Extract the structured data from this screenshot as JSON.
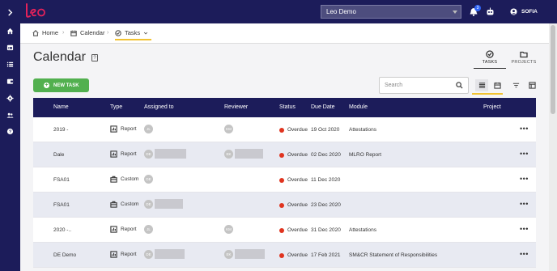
{
  "topbar": {
    "logo_text": "leo",
    "organization": "Leo Demo",
    "notification_count": "3",
    "user_name": "SOFIA"
  },
  "breadcrumb": {
    "home": "Home",
    "calendar": "Calendar",
    "tasks": "Tasks"
  },
  "page": {
    "title": "Calendar",
    "help": "?",
    "tab_tasks": "TASKS",
    "tab_projects": "PROJECTS",
    "new_task": "NEW TASK",
    "search_placeholder": "Search"
  },
  "table": {
    "columns": [
      "Name",
      "Type",
      "Assigned to",
      "Reviewer",
      "Status",
      "Due Date",
      "Module",
      "Project"
    ],
    "rows": [
      {
        "name": "2019 -",
        "type": "Report",
        "type_icon": "report-icon",
        "assignee": "JL",
        "reviewer": "KM",
        "status": "Overdue",
        "due": "19 Oct 2020",
        "module": "Attestations",
        "menu": "•••"
      },
      {
        "name": "Dale",
        "type": "Report",
        "type_icon": "report-icon",
        "assignee": "DE",
        "reviewer": "EK",
        "status": "Overdue",
        "due": "02 Dec 2020",
        "module": "MLRO Report",
        "menu": "•••"
      },
      {
        "name": "FSA01",
        "type": "Custom",
        "type_icon": "briefcase-icon",
        "assignee": "DE",
        "reviewer": "",
        "status": "Overdue",
        "due": "11 Dec 2020",
        "module": "",
        "menu": "•••"
      },
      {
        "name": "FSA01",
        "type": "Custom",
        "type_icon": "briefcase-icon",
        "assignee": "DE",
        "reviewer": "",
        "status": "Overdue",
        "due": "23 Dec 2020",
        "module": "",
        "menu": "•••"
      },
      {
        "name": "2020 -..",
        "type": "Report",
        "type_icon": "report-icon",
        "assignee": "JL",
        "reviewer": "KM",
        "status": "Overdue",
        "due": "31 Dec 2020",
        "module": "Attestations",
        "menu": "•••"
      },
      {
        "name": "DE Demo",
        "type": "Report",
        "type_icon": "report-icon",
        "assignee": "DE",
        "reviewer": "EK",
        "status": "Overdue",
        "due": "17 Feb 2021",
        "module": "SM&CR Statement of Responsibilities",
        "menu": "•••"
      }
    ]
  },
  "colors": {
    "navy": "#1c1c5a",
    "accent": "#f1c232",
    "brand": "#e4225a",
    "success": "#52b04f",
    "overdue": "#e0341f"
  }
}
